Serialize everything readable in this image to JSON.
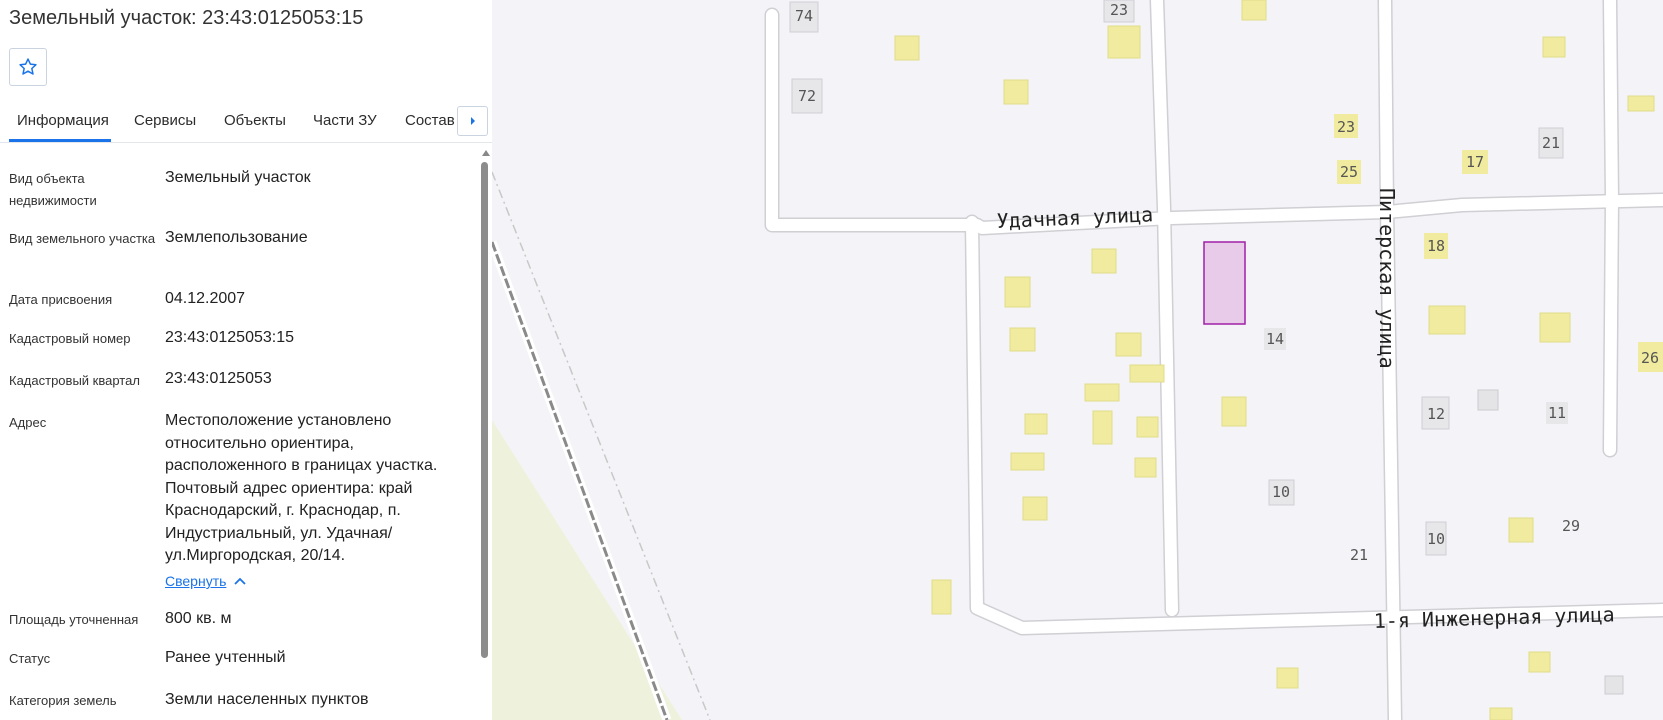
{
  "panel": {
    "title": "Земельный участок: 23:43:0125053:15",
    "favorite_icon": "star-outline-icon",
    "tabs": [
      "Информация",
      "Сервисы",
      "Объекты",
      "Части ЗУ",
      "Состав"
    ],
    "tabs_next_icon": "caret-right-icon",
    "fields": [
      {
        "label": "Вид объекта недвижимости",
        "value": "Земельный участок"
      },
      {
        "label": "Вид земельного участка",
        "value": "Землепользование"
      },
      {
        "label": "Дата присвоения",
        "value": "04.12.2007"
      },
      {
        "label": "Кадастровый номер",
        "value": "23:43:0125053:15"
      },
      {
        "label": "Кадастровый квартал",
        "value": "23:43:0125053"
      },
      {
        "label": "Адрес",
        "value": "Местоположение установлено относительно ориентира, расположенного в границах участка. Почтовый адрес ориентира: край Краснодарский, г. Краснодар, п. Индустриальный, ул. Удачная/ ул.Миргородская, 20/14."
      },
      {
        "label": "Площадь уточненная",
        "value": "800 кв. м"
      },
      {
        "label": "Статус",
        "value": "Ранее учтенный"
      },
      {
        "label": "Категория земель",
        "value": "Земли населенных пунктов"
      }
    ],
    "collapse_label": "Свернуть",
    "collapse_icon": "chevron-up-icon"
  },
  "map": {
    "streets": {
      "udachnaya": "Удачная улица",
      "piterskaya": "Питерская улица",
      "inzhenernaya": "1-я Инженерная улица"
    },
    "house_numbers": {
      "h74": "74",
      "h23a": "23",
      "h72": "72",
      "h23b": "23",
      "h25": "25",
      "h21a": "21",
      "h17": "17",
      "h18": "18",
      "h14": "14",
      "h26": "26",
      "h12": "12",
      "h11": "11",
      "h10a": "10",
      "h29": "29",
      "h10b": "10",
      "h21b": "21"
    },
    "colors": {
      "background": "#f4f4f8",
      "road": "#ffffff",
      "building": "#f0eb9e",
      "parcel_fill": "#e7cbe9",
      "parcel_stroke": "#a020a8",
      "railway": "#8a8a8a"
    }
  }
}
